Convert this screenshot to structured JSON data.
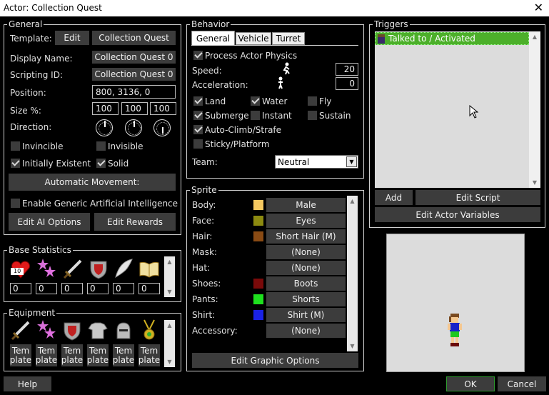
{
  "window": {
    "title": "Actor: Collection Quest",
    "close": "✕"
  },
  "general": {
    "legend": "General",
    "template_label": "Template:",
    "edit_button": "Edit",
    "template_value": "Collection Quest",
    "display_name_label": "Display Name:",
    "display_name": "Collection Quest 0",
    "scripting_id_label": "Scripting ID:",
    "scripting_id": "Collection Quest 0",
    "position_label": "Position:",
    "position": "800, 3136, 0",
    "size_label": "Size %:",
    "size": [
      "100",
      "100",
      "100"
    ],
    "direction_label": "Direction:",
    "invincible": "Invincible",
    "invisible": "Invisible",
    "initially_existent": "Initially Existent",
    "solid": "Solid",
    "auto_movement": "Automatic Movement:",
    "enable_ai": "Enable Generic Artificial Intelligence",
    "edit_ai": "Edit AI Options",
    "edit_rewards": "Edit Rewards"
  },
  "base_stats": {
    "legend": "Base Statistics",
    "hp_badge": "10",
    "values": [
      "0",
      "0",
      "0",
      "0",
      "0",
      "0"
    ]
  },
  "equipment": {
    "legend": "Equipment",
    "slots": [
      {
        "l1": "Tem",
        "l2": "plate"
      },
      {
        "l1": "Tem",
        "l2": "plate"
      },
      {
        "l1": "Tem",
        "l2": "plate"
      },
      {
        "l1": "Tem",
        "l2": "plate"
      },
      {
        "l1": "Tem",
        "l2": "plate"
      },
      {
        "l1": "Tem",
        "l2": "plate"
      }
    ]
  },
  "behavior": {
    "legend": "Behavior",
    "tabs": [
      "General",
      "Vehicle",
      "Turret"
    ],
    "process_physics": "Process Actor Physics",
    "speed_label": "Speed:",
    "speed": "20",
    "accel_label": "Acceleration:",
    "accel": "0",
    "land": "Land",
    "water": "Water",
    "fly": "Fly",
    "submerge": "Submerge",
    "instant": "Instant",
    "sustain": "Sustain",
    "auto_climb": "Auto-Climb/Strafe",
    "sticky": "Sticky/Platform",
    "team_label": "Team:",
    "team": "Neutral"
  },
  "sprite": {
    "legend": "Sprite",
    "rows": [
      {
        "label": "Body:",
        "value": "Male",
        "color": "#f5c860"
      },
      {
        "label": "Face:",
        "value": "Eyes",
        "color": "#8c8a10"
      },
      {
        "label": "Hair:",
        "value": "Short Hair (M)",
        "color": "#8a4b14"
      },
      {
        "label": "Mask:",
        "value": "(None)",
        "color": ""
      },
      {
        "label": "Hat:",
        "value": "(None)",
        "color": ""
      },
      {
        "label": "Shoes:",
        "value": "Boots",
        "color": "#7a0a0a"
      },
      {
        "label": "Pants:",
        "value": "Shorts",
        "color": "#1ee01e"
      },
      {
        "label": "Shirt:",
        "value": "Shirt (M)",
        "color": "#1a22e6"
      },
      {
        "label": "Accessory:",
        "value": "(None)",
        "color": ""
      }
    ],
    "edit_graphic": "Edit Graphic Options"
  },
  "triggers": {
    "legend": "Triggers",
    "items": [
      "Talked to / Activated"
    ],
    "add": "Add",
    "edit_script": "Edit Script",
    "edit_vars": "Edit Actor Variables"
  },
  "footer": {
    "help": "Help",
    "ok": "OK",
    "cancel": "Cancel"
  },
  "colors": {
    "accent_green": "#4caf2a",
    "ok_border": "#2e9a2e",
    "panel_button": "#3c3c3c"
  }
}
